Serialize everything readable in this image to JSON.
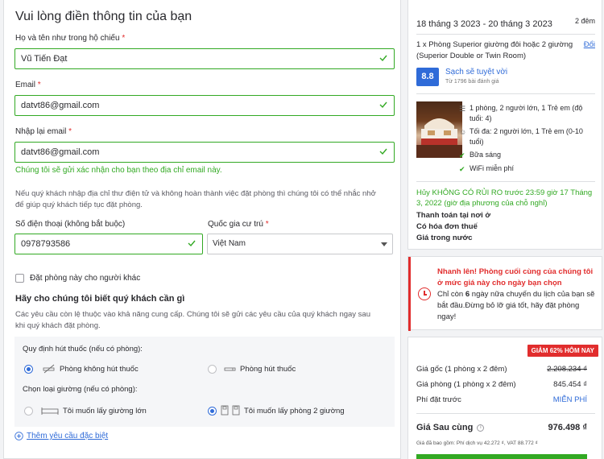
{
  "form": {
    "title": "Vui lòng điền thông tin của bạn",
    "full_name_label": "Họ và tên như trong hộ chiếu",
    "full_name_value": "Vũ Tiến Đạt",
    "email_label": "Email",
    "email_value": "datvt86@gmail.com",
    "email_confirm_label": "Nhập lại email",
    "email_confirm_value": "datvt86@gmail.com",
    "email_confirm_msg": "Chúng tôi sẽ gửi xác nhận cho bạn theo địa chỉ email này.",
    "reminder_note": "Nếu quý khách nhập địa chỉ thư điện tử và không hoàn thành việc đặt phòng thì chúng tôi có thể nhắc nhở để giúp quý khách tiếp tục đặt phòng.",
    "phone_label": "Số điện thoại (không bắt buộc)",
    "phone_value": "0978793586",
    "country_label": "Quốc gia cư trú",
    "country_value": "Việt Nam",
    "book_for_other_label": "Đặt phòng này cho người khác",
    "requests_title": "Hãy cho chúng tôi biết quý khách cần gì",
    "requests_note": "Các yêu cầu còn lệ thuộc vào khả năng cung cấp. Chúng tôi sẽ gửi các yêu cầu của quý khách ngay sau khi quý khách đặt phòng.",
    "smoking_label": "Quy định hút thuốc (nếu có phòng):",
    "non_smoking": "Phòng không hút thuốc",
    "smoking": "Phòng hút thuốc",
    "bed_label": "Chọn loại giường (nếu có phòng):",
    "bed_large": "Tôi muốn lấy giường lớn",
    "bed_twin": "Tôi muốn lấy phòng 2 giường",
    "more_requests": "Thêm yêu cầu đặc biệt"
  },
  "summary": {
    "dates": "18 tháng 3 2023 - 20 tháng 3 2023",
    "nights": "2 đêm",
    "room_line": "1 x Phòng Superior giường đôi hoặc 2 giường (Superior Double or Twin Room)",
    "change_link": "Đổi",
    "score": "8.8",
    "score_title": "Sạch sẽ tuyệt vời",
    "score_sub": "Từ 1796 bài đánh giá",
    "feature_beds": "1 phòng, 2 người lớn, 1 Trẻ em (độ tuổi: 4)",
    "feature_max": "Tối đa: 2 người lớn, 1 Trẻ em (0-10 tuổi)",
    "feature_breakfast": "Bữa sáng",
    "feature_wifi": "WiFi miễn phí",
    "cancel_policy": "Hủy KHÔNG CÓ RỦI RO trước 23:59 giờ 17 Tháng 3, 2022 (giờ địa phương của chỗ nghỉ)",
    "pay_at_hotel": "Thanh toán tại nơi ở",
    "invoice": "Có hóa đơn thuế",
    "local_price": "Giá trong nước"
  },
  "urgency": {
    "title": "Nhanh lên! Phòng cuối cùng của chúng tôi ở mức giá này cho ngày bạn chọn",
    "text_pre": "Chỉ còn ",
    "days": "6",
    "text_post": " ngày nữa chuyến du lịch của bạn sẽ bắt đầu.Đừng bỏ lỡ giá tốt, hãy đặt phòng ngay!"
  },
  "pricing": {
    "discount_badge": "GIẢM 62% HÔM NAY",
    "original_label": "Giá gốc (1 phòng x 2 đêm)",
    "original_value": "2.208.234 ₫",
    "room_label": "Giá phòng (1 phòng x 2 đêm)",
    "room_value": "845.454 ₫",
    "booking_fee_label": "Phí đặt trước",
    "booking_fee_value": "MIỄN PHÍ",
    "final_label": "Giá Sau cùng",
    "final_value": "976.498 ₫",
    "tax_note": "Giá đã bao gồm: Phí dịch vụ 42.272 ₫, VAT 88.772 ₫"
  },
  "colors": {
    "accent_blue": "#2f6bd8",
    "success_green": "#32a923",
    "alert_red": "#e12d2d"
  }
}
